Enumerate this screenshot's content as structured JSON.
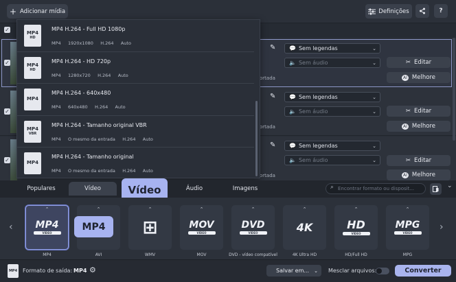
{
  "topbar": {
    "add_media_label": "Adicionar mídia",
    "settings_label": "Definições",
    "help_label": "?"
  },
  "files": [
    {
      "subtitle_value": "Sem legendas",
      "audio_value": "Sem áudio",
      "crop_note": "ortada",
      "edit_label": "Editar",
      "enhance_label": "Melhore"
    },
    {
      "subtitle_value": "Sem legendas",
      "audio_value": "Sem áudio",
      "crop_note": "ortada",
      "edit_label": "Editar",
      "enhance_label": "Melhore"
    },
    {
      "subtitle_value": "Sem legendas",
      "audio_value": "Sem áudio",
      "crop_note": "ortada",
      "edit_label": "Editar",
      "enhance_label": "Melhore"
    }
  ],
  "format_popup": {
    "items": [
      {
        "icon_text": "MP4",
        "icon_sub": "HD",
        "title": "MP4 H.264 - Full HD 1080p",
        "meta": "MP4     1920x1080     H.264     Auto"
      },
      {
        "icon_text": "MP4",
        "icon_sub": "HD",
        "title": "MP4 H.264 - HD 720p",
        "meta": "MP4     1280x720     H.264     Auto"
      },
      {
        "icon_text": "MP4",
        "icon_sub": "",
        "title": "MP4 H.264 - 640x480",
        "meta": "MP4     640x480     H.264     Auto"
      },
      {
        "icon_text": "MP4",
        "icon_sub": "VBR",
        "title": "MP4 H.264 - Tamanho original VBR",
        "meta": "MP4     O mesmo da entrada     H.264     Auto"
      },
      {
        "icon_text": "MP4",
        "icon_sub": "",
        "title": "MP4 H.264 - Tamanho original",
        "meta": "MP4     O mesmo da entrada     H.264     Auto"
      }
    ]
  },
  "format_tabs": {
    "populares": "Populares",
    "video": "Vídeo",
    "audio": "Áudio",
    "imagens": "Imagens",
    "callout": "Vídeo"
  },
  "search": {
    "placeholder": "Encontrar formato ou disposit..."
  },
  "formats": [
    {
      "logo": "MP4",
      "sub": "VIDEO",
      "label": "MP4"
    },
    {
      "logo": "AVI",
      "sub": "",
      "label": "AVI"
    },
    {
      "logo": "WMV",
      "sub": "",
      "label": "WMV"
    },
    {
      "logo": "MOV",
      "sub": "VIDEO",
      "label": "MOV"
    },
    {
      "logo": "DVD",
      "sub": "VIDEO",
      "label": "DVD - vídeo compatível"
    },
    {
      "logo": "4K",
      "sub": "",
      "label": "4K Ultra HD"
    },
    {
      "logo": "HD",
      "sub": "VIDEO",
      "label": "HD/Full HD"
    },
    {
      "logo": "MPG",
      "sub": "VIDEO",
      "label": "MPG"
    }
  ],
  "format_callout": "MP4",
  "bottom": {
    "output_format_label": "Formato de saída:",
    "output_format_value": "MP4",
    "output_icon_text": "MP4",
    "save_label": "Salvar em...",
    "merge_label": "Mesclar arquivos:",
    "convert_label": "Converter"
  },
  "colors": {
    "accent": "#a9b4ee",
    "background": "#2a2f38"
  }
}
